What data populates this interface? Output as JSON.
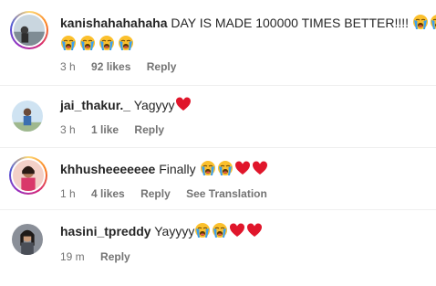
{
  "comments": [
    {
      "username": "kanishahahahaha",
      "text": "DAY IS MADE 100000 TIMES BETTER!!!!",
      "time": "3 h",
      "likes": "92 likes",
      "reply": "Reply",
      "story_ring": true
    },
    {
      "username": "jai_thakur._",
      "text": "Yagyyy",
      "time": "3 h",
      "likes": "1 like",
      "reply": "Reply",
      "story_ring": false
    },
    {
      "username": "khhusheeeeeee",
      "text": "Finally",
      "time": "1 h",
      "likes": "4 likes",
      "reply": "Reply",
      "translate": "See Translation",
      "story_ring": true
    },
    {
      "username": "hasini_tpreddy",
      "text": "Yayyyy",
      "time": "19 m",
      "reply": "Reply",
      "story_ring": false
    }
  ],
  "icons": {
    "crying": "loudly-crying-face-emoji",
    "heart": "red-heart-emoji"
  },
  "colors": {
    "text": "#262626",
    "meta": "#737373",
    "heart": "#e0162b",
    "emoji_face": "#fbc02d",
    "tears": "#3aa0f0"
  }
}
